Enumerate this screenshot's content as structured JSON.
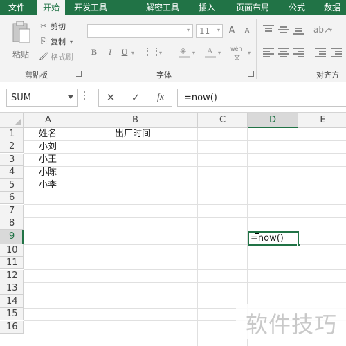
{
  "ribbon_tabs": [
    "文件",
    "开始",
    "开发工具",
    "解密工具",
    "插入",
    "页面布局",
    "公式",
    "数据"
  ],
  "active_tab": "开始",
  "clipboard": {
    "paste_label": "粘贴",
    "cut_label": "剪切",
    "copy_label": "复制",
    "format_painter_label": "格式刷",
    "group_label": "剪贴板"
  },
  "font": {
    "font_name": "",
    "font_size": "11",
    "grow_icon": "A",
    "shrink_icon": "A",
    "bold": "B",
    "italic": "I",
    "underline": "U",
    "phonetic": "wén",
    "phonetic_sub": "文",
    "group_label": "字体"
  },
  "alignment": {
    "group_label": "对齐方式"
  },
  "formula_bar": {
    "name_box": "SUM",
    "cancel_icon": "✕",
    "enter_icon": "✓",
    "fx_icon": "fx",
    "formula": "=now()"
  },
  "sheet": {
    "columns": [
      "A",
      "B",
      "C",
      "D",
      "E"
    ],
    "selected_column": "D",
    "rows": [
      "1",
      "2",
      "3",
      "4",
      "5",
      "6",
      "7",
      "8",
      "9",
      "10",
      "11",
      "12",
      "13",
      "14",
      "15",
      "16"
    ],
    "selected_row": "9",
    "cells": {
      "A1": "姓名",
      "B1": "出厂时间",
      "A2": "小刘",
      "A3": "小王",
      "A4": "小陈",
      "A5": "小李"
    },
    "active_cell_text": "=now()"
  },
  "watermark": "软件技巧",
  "colors": {
    "accent": "#217346",
    "ribbon_bg": "#f3f3f3",
    "header_bg": "#f3f3f3",
    "selected_header_bg": "#d9d9d9"
  }
}
